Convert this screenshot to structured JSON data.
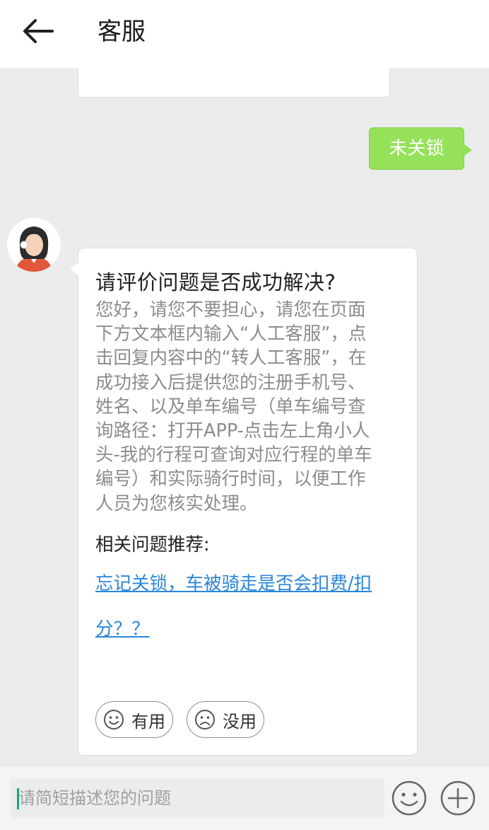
{
  "header": {
    "title": "客服",
    "back_icon": "arrow-left-icon"
  },
  "messages": {
    "user_text": "未关锁",
    "bot": {
      "question": "请评价问题是否成功解决?",
      "answer": "您好，请您不要担心，请您在页面下方文本框内输入“人工客服”，点击回复内容中的“转人工客服”，在成功接入后提供您的注册手机号、姓名、以及单车编号（单车编号查询路径：打开APP-点击左上角小人头-我的行程可查询对应行程的单车编号）和实际骑行时间，以便工作人员为您核实处理。",
      "related_label": "相关问题推荐:",
      "related_link": "忘记关锁，车被骑走是否会扣费/扣分？？",
      "useful_label": "有用",
      "useless_label": "没用"
    }
  },
  "input": {
    "placeholder": "请简短描述您的问题",
    "value": ""
  },
  "colors": {
    "user_bubble": "#95e15a",
    "link": "#2a86d9",
    "caret": "#1aa57d"
  }
}
